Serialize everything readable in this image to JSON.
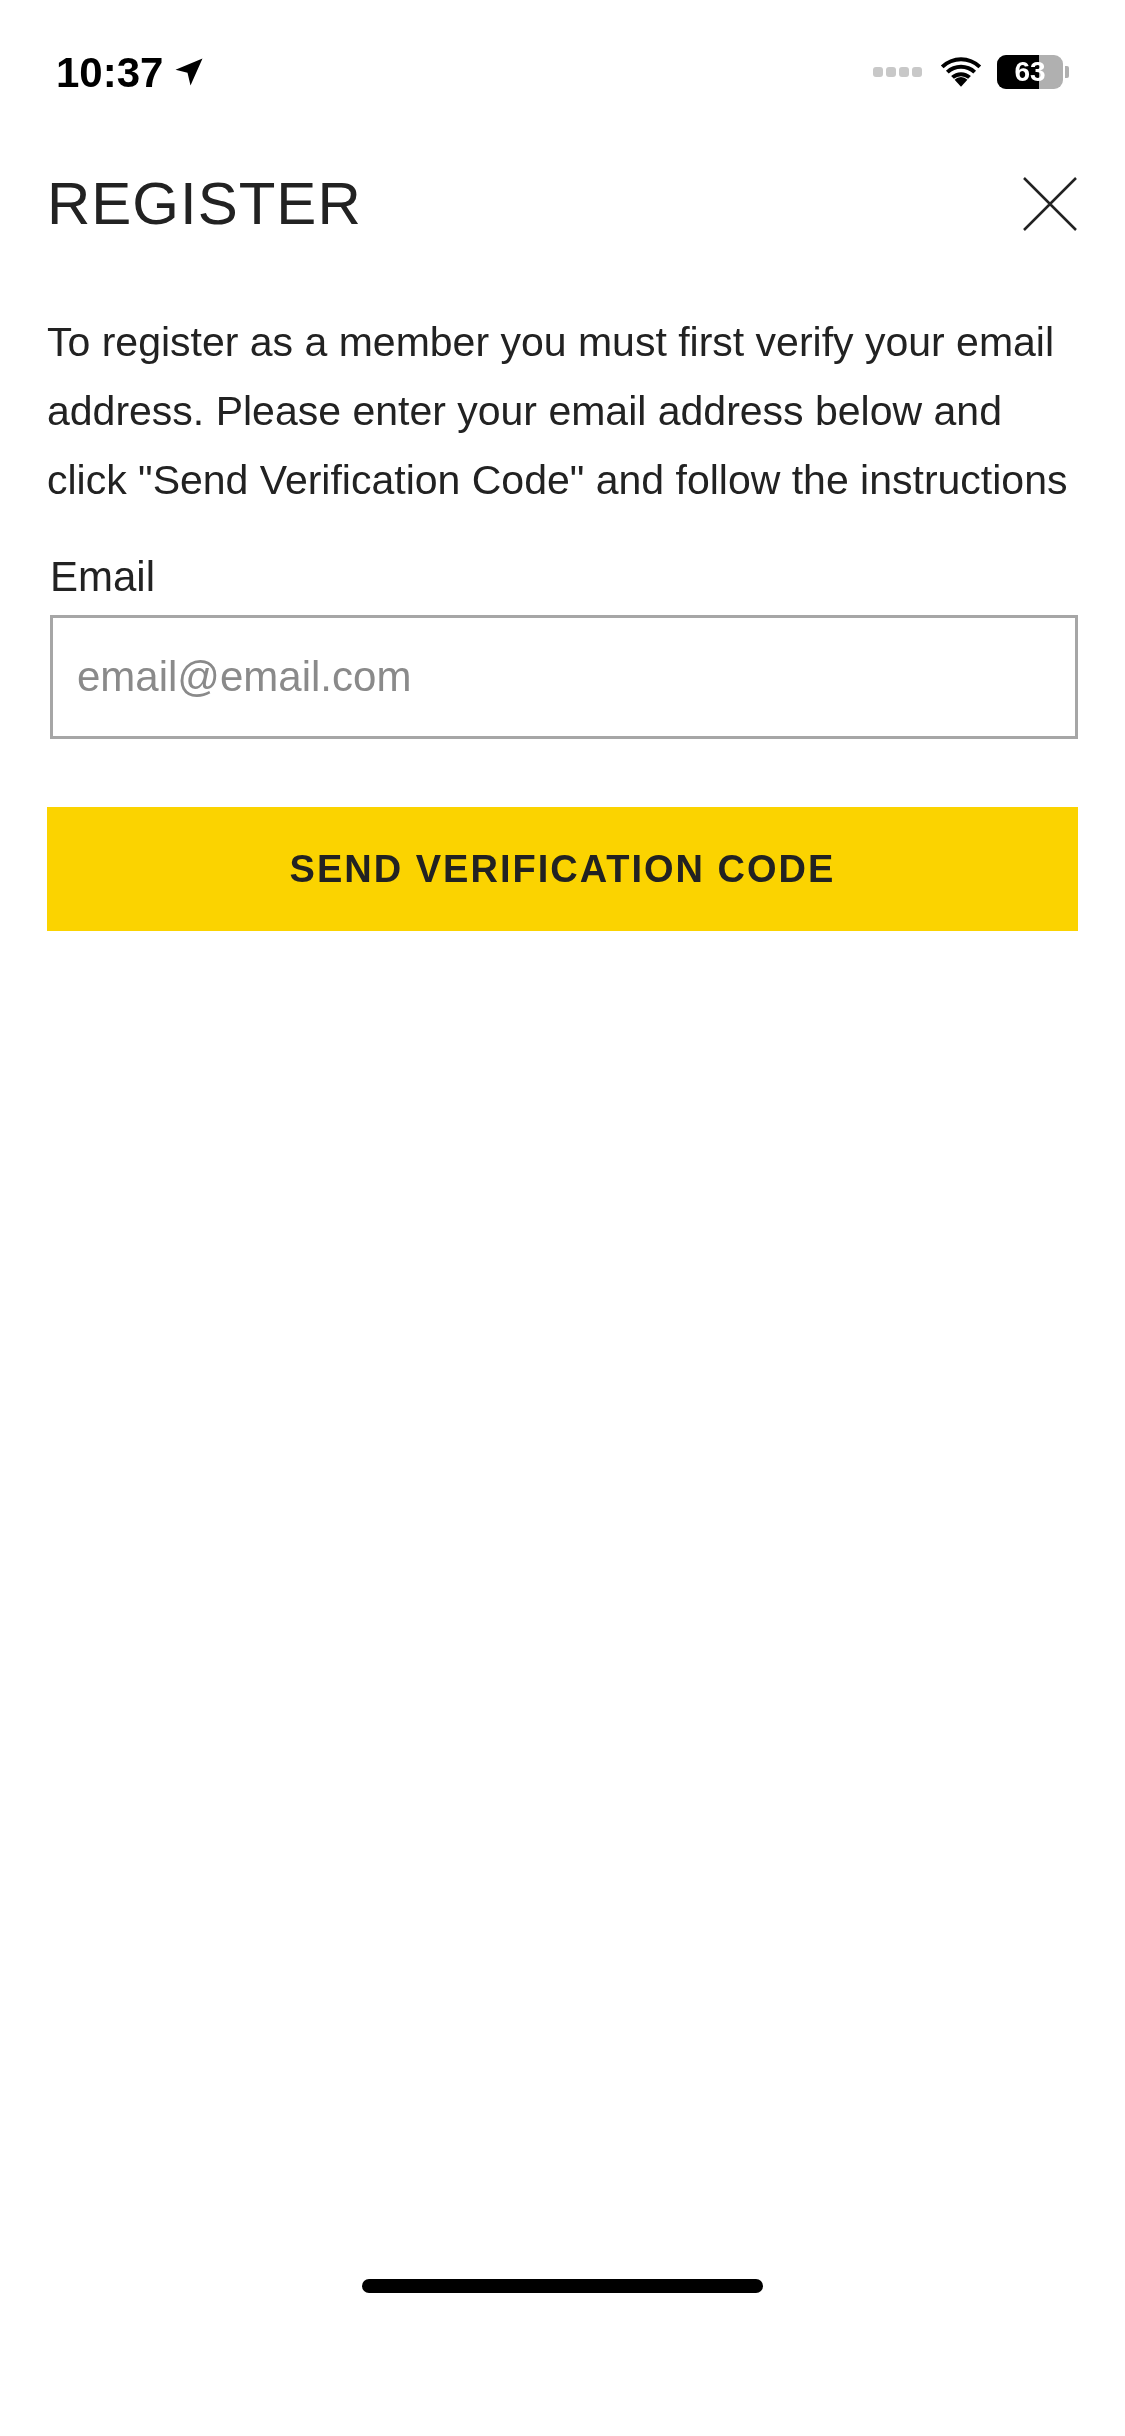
{
  "status_bar": {
    "time": "10:37",
    "battery": "63"
  },
  "header": {
    "title": "REGISTER"
  },
  "intro": "To register as a member you must first verify your email address. Please enter your email address below and click \"Send Verification Code\" and follow the instructions",
  "email_field": {
    "label": "Email",
    "placeholder": "email@email.com"
  },
  "submit_button": {
    "label": "SEND VERIFICATION CODE"
  }
}
